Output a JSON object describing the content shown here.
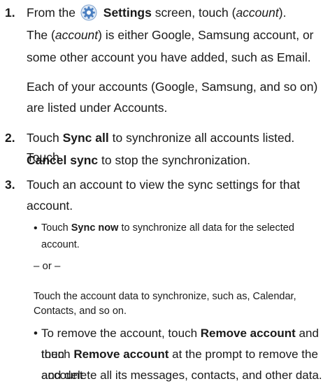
{
  "steps": [
    {
      "number": "1.",
      "line1_prefix": "From the",
      "settings_label": "Settings",
      "line1_mid": "screen, touch (",
      "account_word": "account",
      "line1_suffix": ").",
      "line2_prefix": "The (",
      "line2_account": "account",
      "line2_rest": ") is either Google, Samsung account, or",
      "line3": "some other account you have added, such as Email.",
      "para2_line1": "Each of your accounts (Google, Samsung, and so on)",
      "para2_line2": "are listed under Accounts."
    },
    {
      "number": "2.",
      "line1_prefix": "Touch",
      "sync_all": "Sync all",
      "line1_rest": "to synchronize all accounts listed. Touch",
      "cancel_sync": "Cancel sync",
      "line2_rest": "to stop the synchronization."
    },
    {
      "number": "3.",
      "line1": "Touch an account to view the sync settings for that",
      "line2": "account.",
      "bullet1_prefix": "Touch",
      "sync_now": "Sync now",
      "bullet1_rest": "to synchronize all data for the selected",
      "bullet1_line2": "account.",
      "or_text": "– or –",
      "alt_line1": "Touch the account data to synchronize, such as, Calendar,",
      "alt_line2": "Contacts, and so on.",
      "bullet2_line1_prefix": "To remove the account, touch",
      "remove_account": "Remove account",
      "bullet2_line1_rest": "and then",
      "bullet2_line2_prefix": "touch",
      "remove_account_2": "Remove account",
      "bullet2_line2_rest": "at the prompt to remove the account",
      "bullet2_line3": "and delete all its messages, contacts, and other data."
    }
  ],
  "icons": {
    "settings": "settings-gear-icon",
    "settings_color": "#4a7fc1"
  }
}
